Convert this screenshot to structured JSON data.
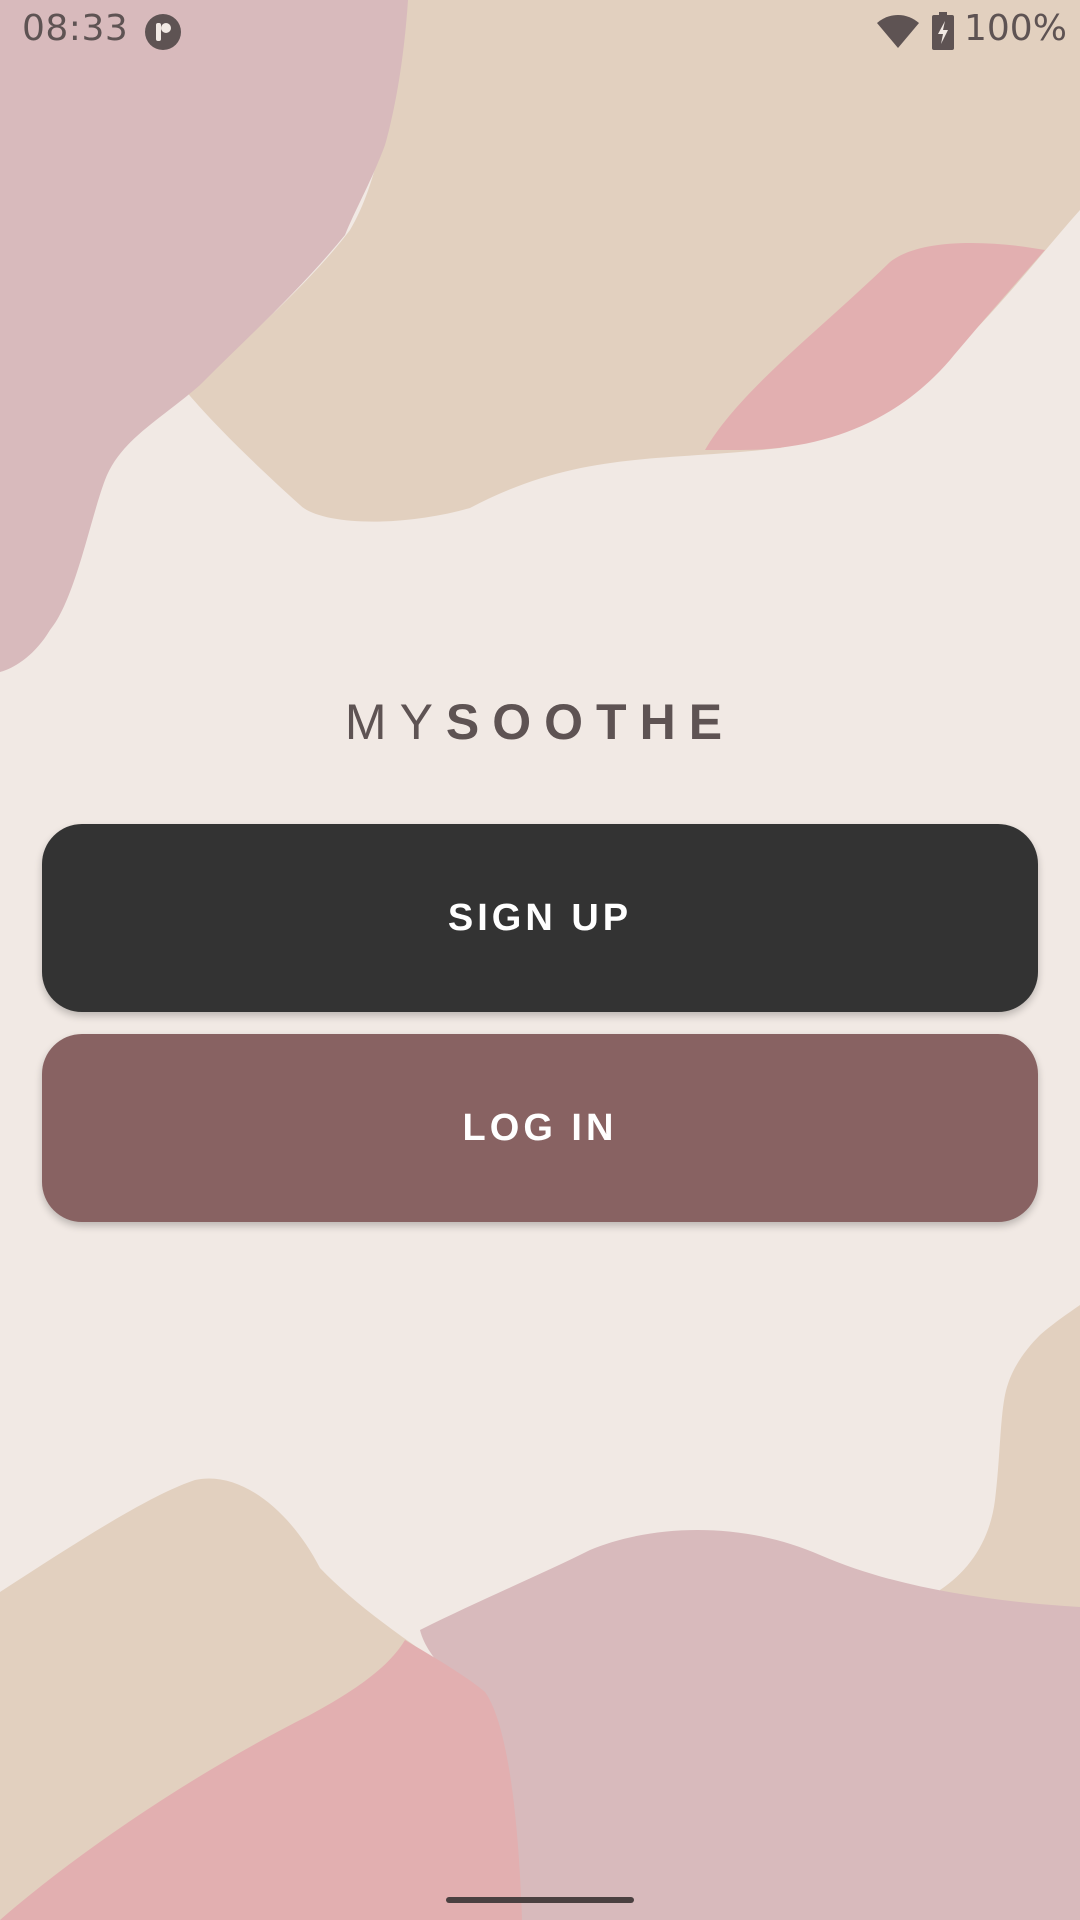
{
  "status_bar": {
    "time": "08:33",
    "app_icon": "app-notification-icon",
    "wifi_icon": "wifi-icon",
    "battery_icon": "battery-charging-icon",
    "battery_percent": "100%"
  },
  "logo": {
    "prefix": "MY",
    "name": "SOOTHE"
  },
  "buttons": {
    "signup_label": "SIGN UP",
    "login_label": "LOG IN"
  },
  "colors": {
    "background": "#F1E9E4",
    "signup_button": "#333333",
    "login_button": "#886262",
    "shape_beige": "#E2D0BF",
    "shape_mauve": "#D8BABC",
    "shape_pink": "#E2AFB0",
    "text": "#5E5353"
  }
}
